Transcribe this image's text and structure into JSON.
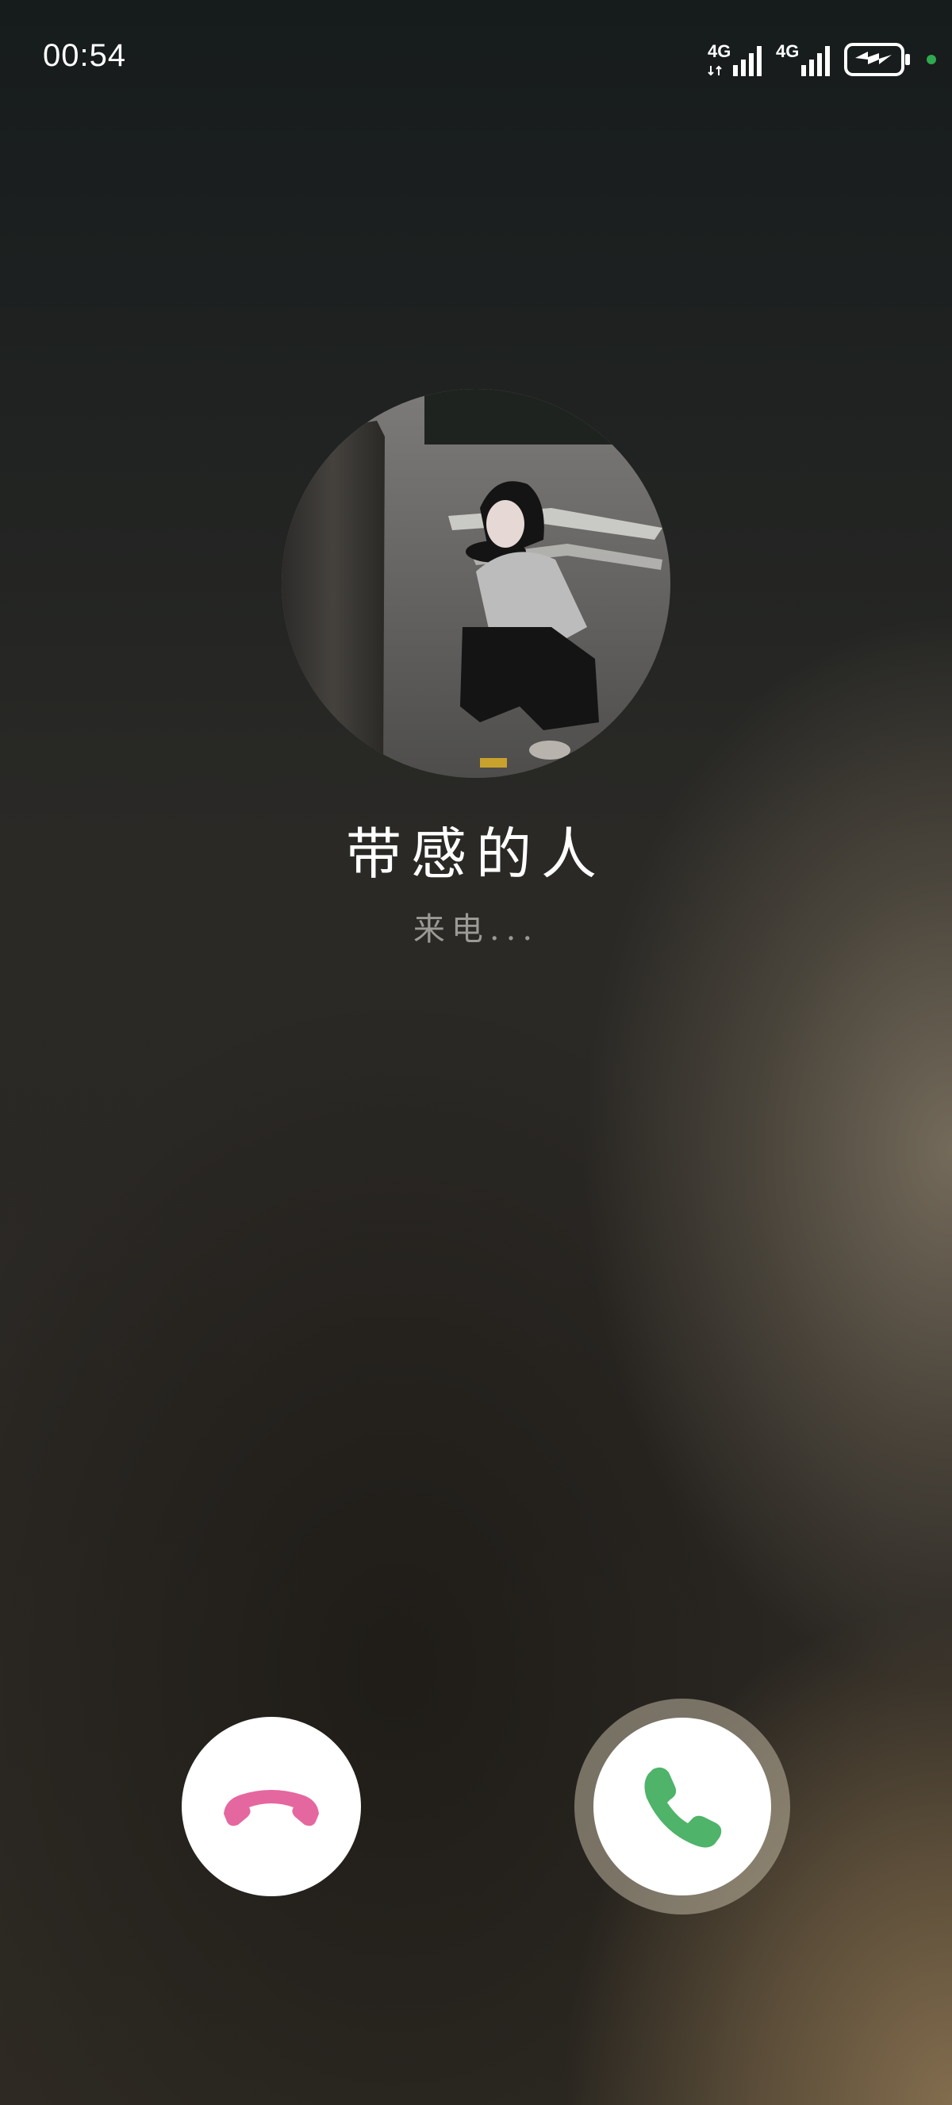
{
  "status_bar": {
    "time": "00:54",
    "sim1_network": "4G",
    "sim2_network": "4G",
    "battery_icon": "battery-charging-icon",
    "indicator_color": "#2fa84f"
  },
  "caller": {
    "name": "带感的人",
    "status": "来电..."
  },
  "actions": {
    "decline_icon": "hang-up-icon",
    "decline_color": "#e5679f",
    "answer_icon": "phone-icon",
    "answer_color": "#4fb36a"
  }
}
